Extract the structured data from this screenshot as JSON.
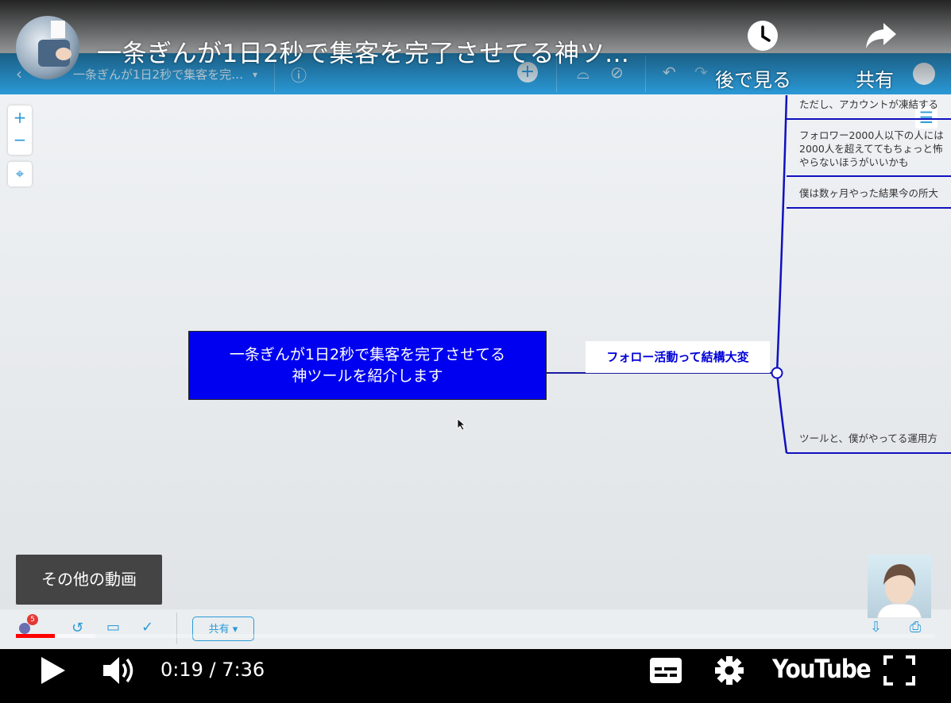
{
  "overlay": {
    "video_title": "一条ぎんが1日2秒で集客を完了させてる神ツ…",
    "watch_later_label": "後で見る",
    "share_label": "共有"
  },
  "app": {
    "doc_title": "一条ぎんが1日2秒で集客を完…",
    "share_button": "共有",
    "notification_count": "5"
  },
  "mindmap": {
    "central_line1": "一条ぎんが1日2秒で集客を完了させてる",
    "central_line2": "神ツールを紹介します",
    "branch": "フォロー活動って結構大変",
    "sub1": "ただし、アカウントが凍結する",
    "sub2_line1": "フォロワー2000人以下の人には",
    "sub2_line2": "2000人を超えててもちょっと怖",
    "sub2_line3": "やらないほうがいいかも",
    "sub3": "僕は数ヶ月やった結果今の所大",
    "sub4": "ツールと、僕がやってる運用方"
  },
  "endscreen": {
    "more_videos": "その他の動画"
  },
  "player": {
    "current_time": "0:19",
    "separator": " / ",
    "duration": "7:36",
    "progress_fraction": 0.042,
    "logo_text": "YouTube",
    "accent_color": "#ff0000"
  }
}
